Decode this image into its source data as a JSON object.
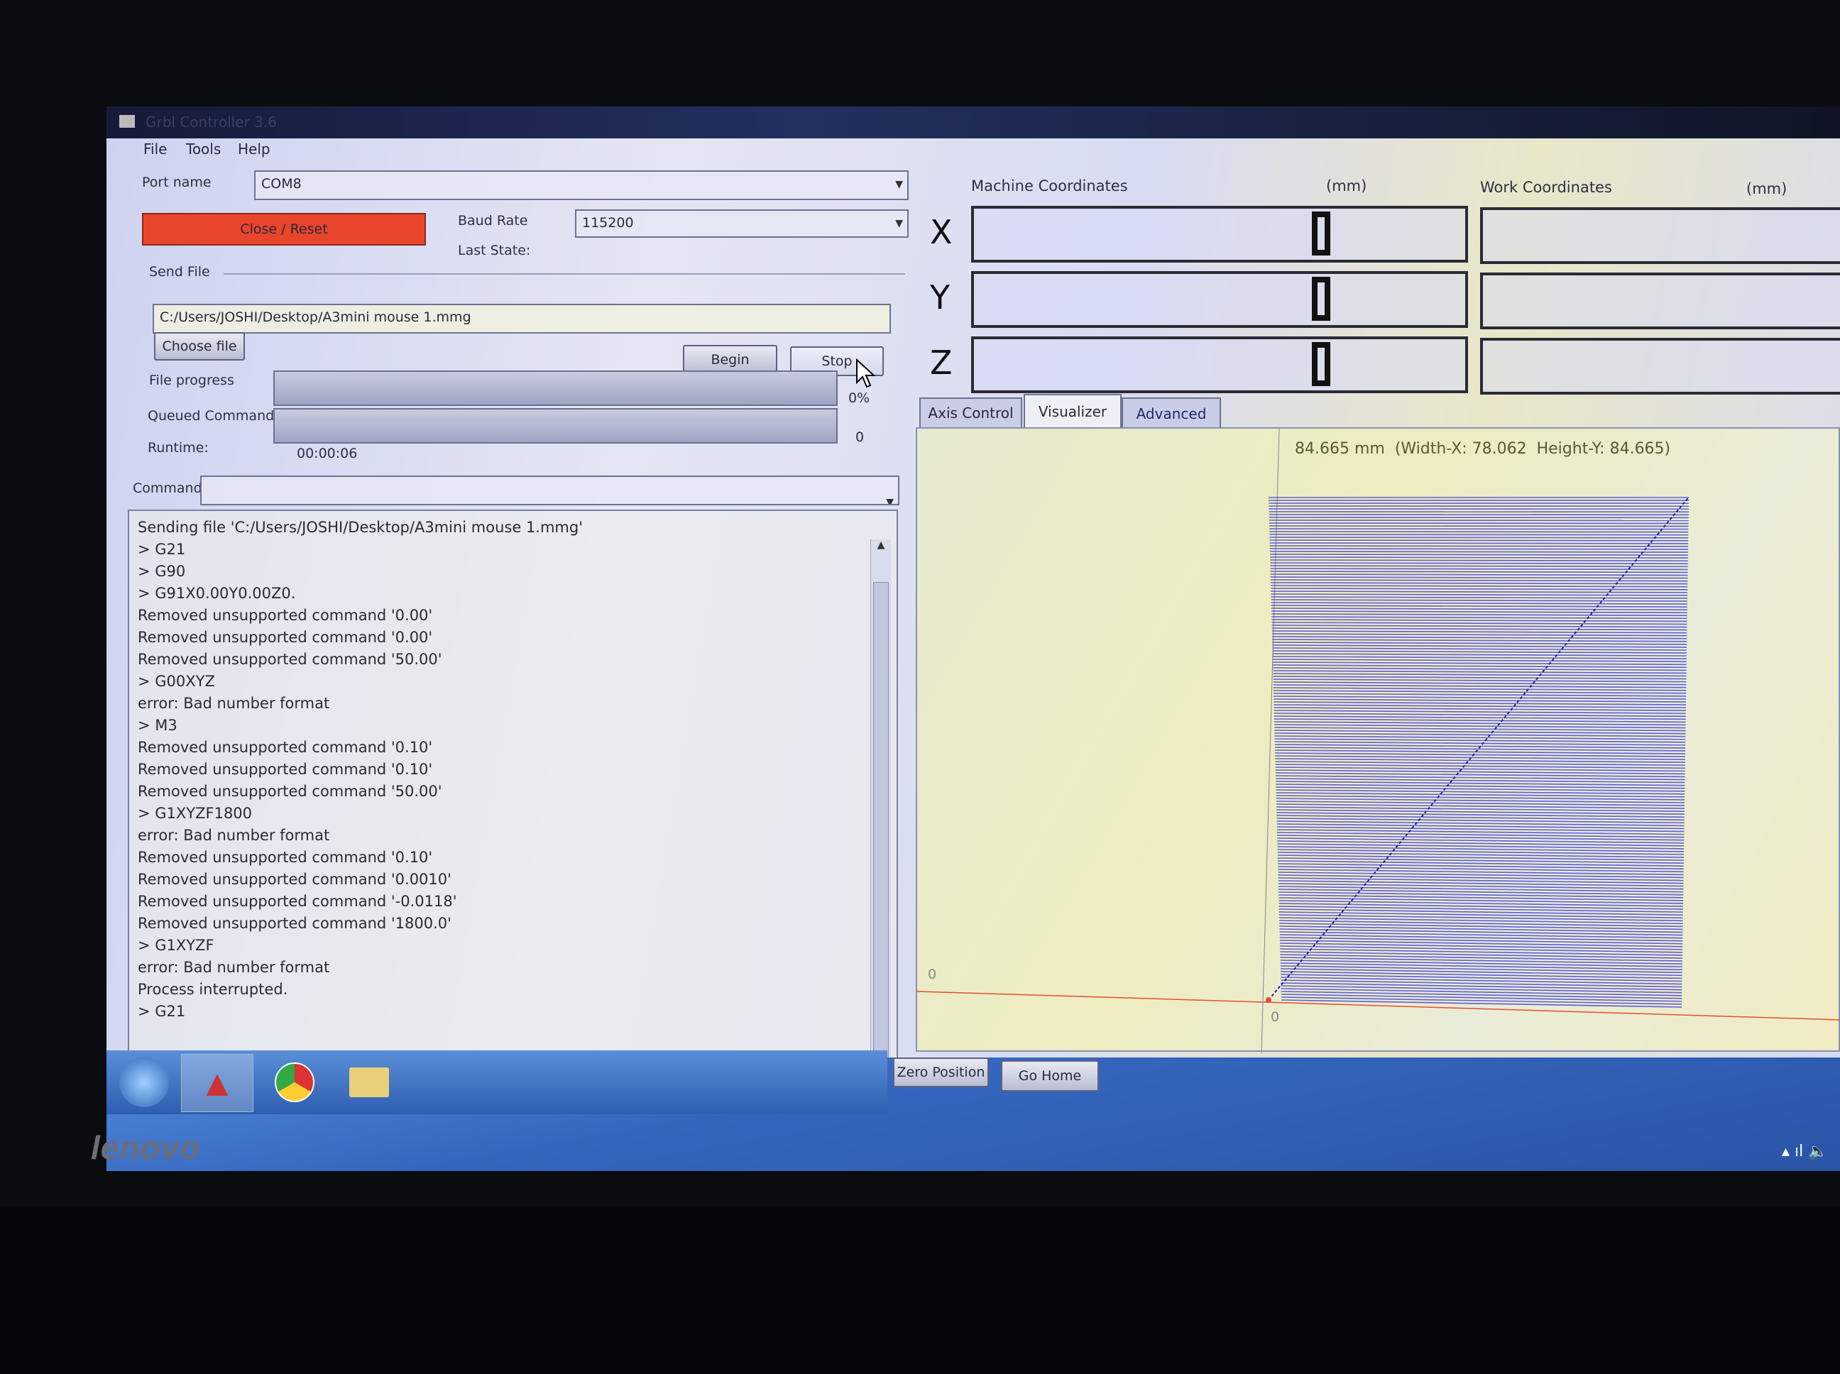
{
  "window": {
    "title": "Grbl Controller 3.6"
  },
  "menu": [
    "File",
    "Tools",
    "Help"
  ],
  "connection": {
    "port_label": "Port name",
    "port_value": "COM8",
    "close_reset": "Close / Reset",
    "baud_label": "Baud Rate",
    "baud_value": "115200",
    "last_state_label": "Last State:"
  },
  "send_file": {
    "group_label": "Send File",
    "path": "C:/Users/JOSHI/Desktop/A3mini mouse 1.mmg",
    "choose_file": "Choose file",
    "begin": "Begin",
    "stop": "Stop",
    "file_progress_label": "File progress",
    "file_progress_value": "0%",
    "file_progress": 0,
    "queued_label": "Queued Commands",
    "queued_value": "0",
    "runtime_label": "Runtime:",
    "runtime_value": "00:00:06"
  },
  "command": {
    "label": "Command",
    "value": ""
  },
  "log": [
    "Sending file 'C:/Users/JOSHI/Desktop/A3mini mouse 1.mmg'",
    "> G21",
    "> G90",
    "> G91X0.00Y0.00Z0.",
    "Removed unsupported command '0.00'",
    "Removed unsupported command '0.00'",
    "Removed unsupported command '50.00'",
    "> G00XYZ",
    "error: Bad number format",
    "> M3",
    "Removed unsupported command '0.10'",
    "Removed unsupported command '0.10'",
    "Removed unsupported command '50.00'",
    "> G1XYZF1800",
    "error: Bad number format",
    "Removed unsupported command '0.10'",
    "Removed unsupported command '0.0010'",
    "Removed unsupported command '-0.0118'",
    "Removed unsupported command '1800.0'",
    "> G1XYZF",
    "error: Bad number format",
    "Process interrupted.",
    "> G21"
  ],
  "coordinates": {
    "machine_label": "Machine Coordinates",
    "work_label": "Work Coordinates",
    "unit": "(mm)",
    "axes": [
      {
        "axis": "X",
        "machine": "0",
        "work": ""
      },
      {
        "axis": "Y",
        "machine": "0",
        "work": ""
      },
      {
        "axis": "Z",
        "machine": "0",
        "work": ""
      }
    ]
  },
  "tabs": [
    {
      "label": "Axis Control",
      "active": false
    },
    {
      "label": "Visualizer",
      "active": true
    },
    {
      "label": "Advanced",
      "active": false
    }
  ],
  "visualizer": {
    "info": "84.665 mm  (Width-X: 78.062  Height-Y: 84.665)",
    "width_x": 78.062,
    "height_y": 84.665,
    "origin_x_label": "0",
    "origin_y_label": "0",
    "fill_color": "#3a3ad8",
    "axis_color": "#e05030"
  },
  "bottom_buttons": {
    "zero_position": "Zero Position",
    "go_home": "Go Home"
  },
  "taskbar": {
    "icons": [
      "start-orb-icon",
      "grbl-app-icon",
      "chrome-icon",
      "explorer-folder-icon"
    ]
  },
  "bezel": {
    "brand": "lenovo"
  },
  "colors": {
    "close_reset": "#e8452a",
    "taskbar": "#3b6fc4"
  }
}
